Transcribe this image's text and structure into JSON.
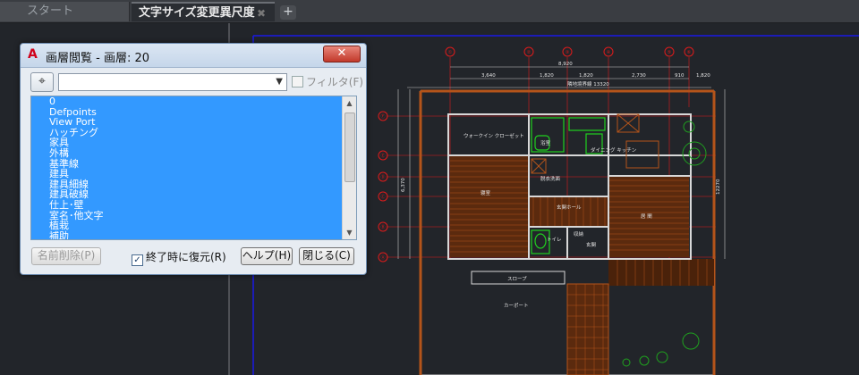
{
  "tabs": [
    {
      "label": "スタート"
    },
    {
      "label": "文字サイズ変更異尺度",
      "close": "✖"
    }
  ],
  "new_tab_symbol": "+",
  "dialog": {
    "title": "画層閲覧 - 画層: 20",
    "close_symbol": "✕",
    "filter_label": "フィルタ(F)",
    "layers": [
      "0",
      "Defpoints",
      "View Port",
      "ハッチング",
      "家具",
      "外構",
      "基準線",
      "建具",
      "建具細線",
      "建具破線",
      "仕上･壁",
      "室名･他文字",
      "植栽",
      "補助"
    ],
    "buttons": {
      "delete": "名前削除(P)",
      "restore": "終了時に復元(R)",
      "help": "ヘルプ(H)",
      "close": "閉じる(C)"
    },
    "restore_checked": true
  },
  "drawing": {
    "total_width_dim": "8,920",
    "site_dim": "隣地境界線 13320",
    "top_dims": [
      "3,640",
      "1,820",
      "1,820",
      "2,730",
      "910",
      "1,820"
    ],
    "left_total_dim": "6,370",
    "left_dims": [
      "1,200",
      "1,820",
      "910",
      "910",
      "1,365",
      "1,365"
    ],
    "right_dim": "12270",
    "axis_top_marks": [
      "①",
      "②",
      "③",
      "④",
      "⑤",
      "⑥"
    ],
    "axis_left_marks": [
      "Ⓕ",
      "Ⓔ",
      "Ⓓ",
      "Ⓒ",
      "Ⓑ",
      "Ⓐ"
    ],
    "room_labels": {
      "walkin": "ウォークイン\nクローゼット",
      "bath": "浴室",
      "dining": "ダイニング\nキッチン",
      "bedroom": "寝室",
      "washroom": "脱衣洗面",
      "hall": "玄関ホール",
      "living": "居 間",
      "toilet": "トイレ",
      "storage": "収納",
      "entry": "玄関",
      "slope": "スロープ",
      "carport": "カーポート"
    },
    "colors": {
      "wall": "#c8c8c8",
      "floor": "#b4541a",
      "fixture": "#1fd01f",
      "axis": "#e01b1b",
      "frame": "#1a1ae6"
    }
  }
}
